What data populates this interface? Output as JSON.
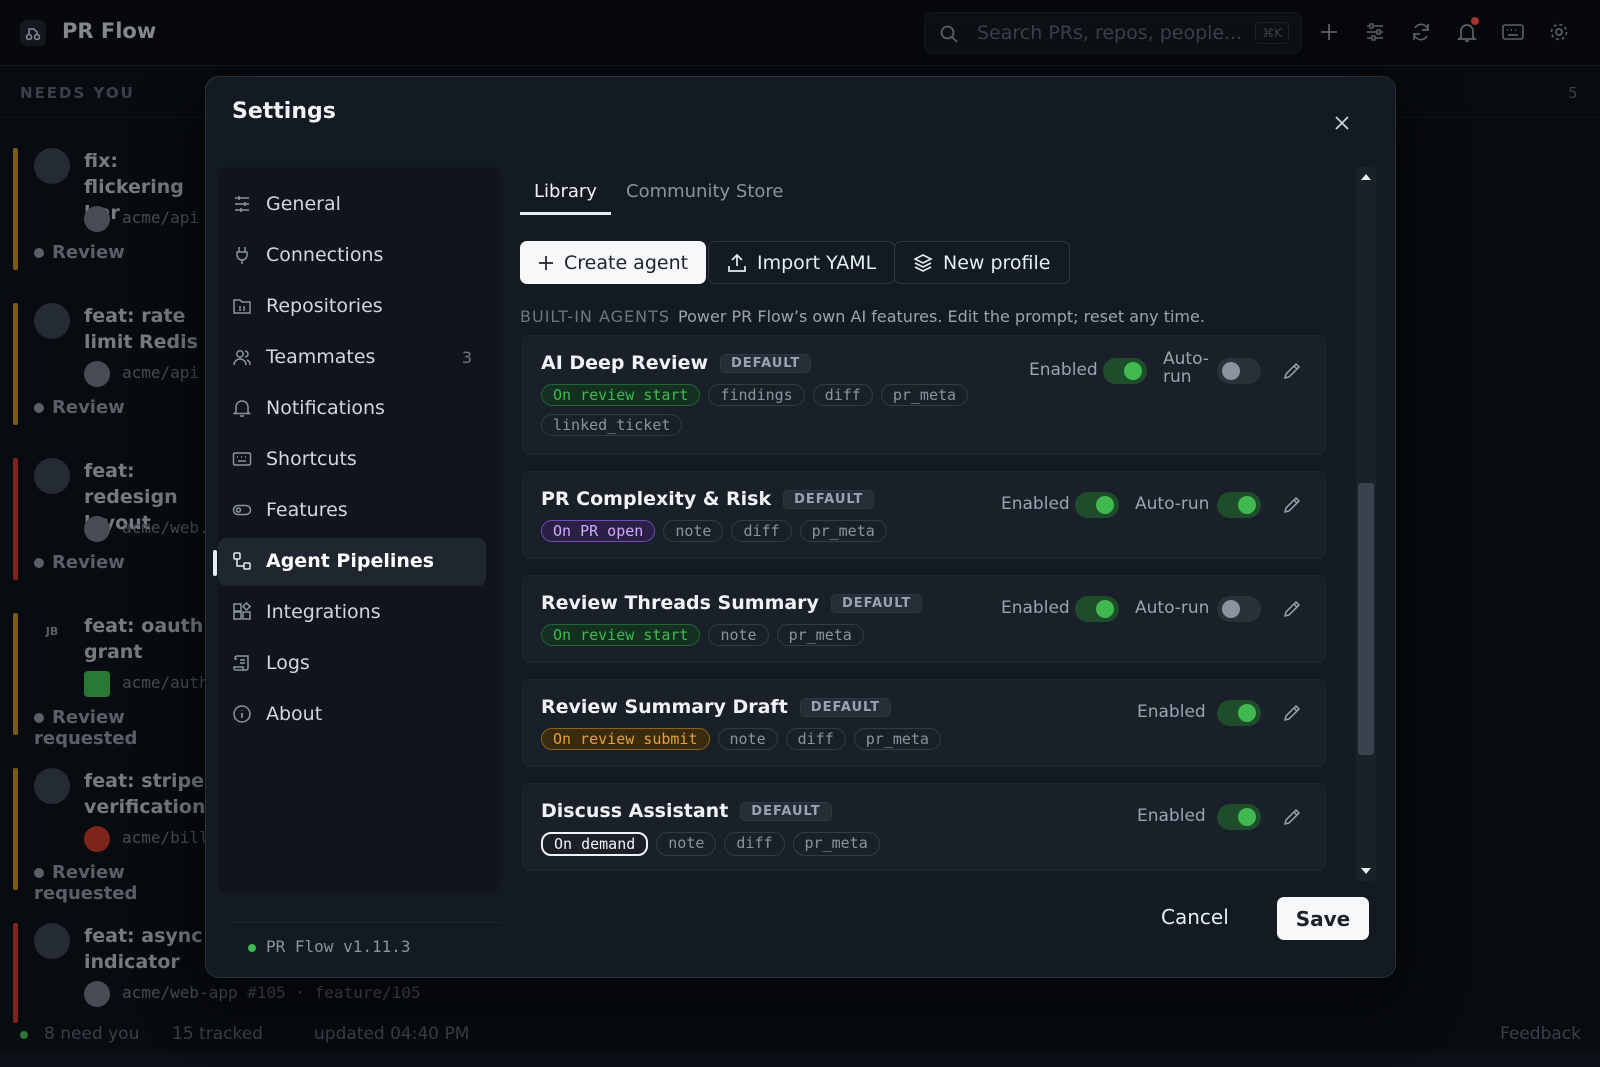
{
  "app": {
    "title": "PR Flow"
  },
  "search": {
    "placeholder": "Search PRs, repos, people...",
    "shortcut": "⌘K"
  },
  "topbar_icons": [
    "plus-icon",
    "sliders-icon",
    "refresh-icon",
    "bell-icon",
    "keyboard-icon",
    "gear-icon"
  ],
  "queue": {
    "heading": "NEEDS YOU",
    "count": "5",
    "items": [
      {
        "title": "fix: flickering bar",
        "repo": "acme/api",
        "status": "Review",
        "bar_color": "#b98b1f"
      },
      {
        "title": "feat: rate limit Redis",
        "repo": "acme/api",
        "status": "Review",
        "bar_color": "#b98b1f"
      },
      {
        "title": "feat: redesign layout",
        "repo": "acme/web...",
        "status": "Review",
        "bar_color": "#c0392b"
      },
      {
        "title": "feat: oauth grant",
        "repo": "acme/auth",
        "status": "Review requested",
        "bar_color": "#b98b1f",
        "avatar_initials": "JB"
      },
      {
        "title": "feat: stripe verification",
        "repo": "acme/bill",
        "status": "Review requested",
        "bar_color": "#b98b1f"
      },
      {
        "title": "feat: async indicator",
        "repo": "acme/web-app #105 · feature/105",
        "status": "",
        "bar_color": "#c0392b"
      }
    ]
  },
  "statusbar": {
    "need_you": "8 need you",
    "tracked": "15 tracked",
    "updated": "updated 04:40 PM",
    "feedback": "Feedback"
  },
  "settings": {
    "title": "Settings",
    "nav": [
      {
        "label": "General",
        "icon": "sliders-icon"
      },
      {
        "label": "Connections",
        "icon": "plug-icon"
      },
      {
        "label": "Repositories",
        "icon": "repo-icon"
      },
      {
        "label": "Teammates",
        "icon": "users-icon",
        "count": "3"
      },
      {
        "label": "Notifications",
        "icon": "bell-icon"
      },
      {
        "label": "Shortcuts",
        "icon": "keyboard-icon"
      },
      {
        "label": "Features",
        "icon": "toggle-icon"
      },
      {
        "label": "Agent Pipelines",
        "icon": "workflow-icon",
        "active": true
      },
      {
        "label": "Integrations",
        "icon": "blocks-icon"
      },
      {
        "label": "Logs",
        "icon": "scroll-icon"
      },
      {
        "label": "About",
        "icon": "info-icon"
      }
    ],
    "version": "PR Flow v1.11.3",
    "tabs": {
      "library": "Library",
      "store": "Community Store"
    },
    "actions": {
      "create": "Create agent",
      "import": "Import YAML",
      "new_profile": "New profile"
    },
    "section": {
      "caption": "BUILT-IN AGENTS",
      "description": "Power PR Flow’s own AI features. Edit the prompt; reset any time."
    },
    "default_badge": "DEFAULT",
    "enabled_label": "Enabled",
    "autorun_label": "Auto-run",
    "autorun_wrapped_1": "Auto-",
    "autorun_wrapped_2": "run",
    "agents": [
      {
        "name": "AI Deep Review",
        "trigger": "On review start",
        "tags": [
          "findings",
          "diff",
          "pr_meta",
          "linked_ticket"
        ],
        "enabled": true,
        "autorun": false
      },
      {
        "name": "PR Complexity & Risk",
        "trigger": "On PR open",
        "tags": [
          "note",
          "diff",
          "pr_meta"
        ],
        "enabled": true,
        "autorun": true
      },
      {
        "name": "Review Threads Summary",
        "trigger": "On review start",
        "tags": [
          "note",
          "pr_meta"
        ],
        "enabled": true,
        "autorun": false
      },
      {
        "name": "Review Summary Draft",
        "trigger": "On review submit",
        "tags": [
          "note",
          "diff",
          "pr_meta"
        ],
        "enabled": true
      },
      {
        "name": "Discuss Assistant",
        "trigger": "On demand",
        "tags": [
          "note",
          "diff",
          "pr_meta"
        ],
        "enabled": true
      }
    ],
    "footer": {
      "cancel": "Cancel",
      "save": "Save"
    }
  }
}
